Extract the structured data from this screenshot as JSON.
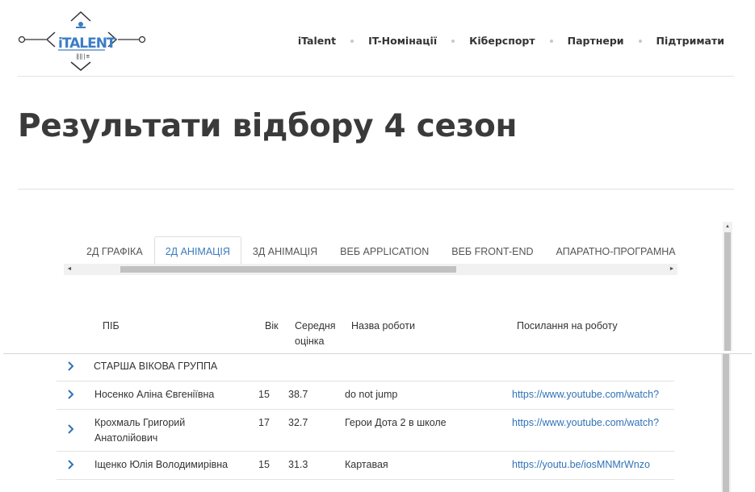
{
  "header": {
    "nav": [
      "iTalent",
      "IT-Номінації",
      "Кіберспорт",
      "Партнери",
      "Підтримати"
    ]
  },
  "page": {
    "title": "Результати відбору 4 сезон"
  },
  "tabs": {
    "items": [
      "2Д ГРАФІКА",
      "2Д АНІМАЦІЯ",
      "3Д АНІМАЦІЯ",
      "ВЕБ APPLICATION",
      "ВЕБ FRONT-END",
      "АПАРАТНО-ПРОГРАМНА РОЗ"
    ],
    "active_index": 1
  },
  "table": {
    "headers": {
      "name": "ПІБ",
      "age": "Вік",
      "score_line1": "Середня",
      "score_line2": "оцінка",
      "work": "Назва роботи",
      "link": "Посилання на роботу"
    },
    "group_label": "СТАРША ВІКОВА ГРУППА",
    "rows": [
      {
        "name": "Носенко Аліна Євгеніївна",
        "age": "15",
        "score": "38.7",
        "work": "do not jump",
        "link": "https://www.youtube.com/watch?"
      },
      {
        "name_line1": "Крохмаль Григорий",
        "name_line2": "Анатолійович",
        "age": "17",
        "score": "32.7",
        "work": "Герои Дота 2 в школе",
        "link": "https://www.youtube.com/watch?"
      },
      {
        "name": "Іщенко Юлія Володимирівна",
        "age": "15",
        "score": "31.3",
        "work": "Картавая",
        "link": "https://youtu.be/iosMNMrWnzo"
      }
    ]
  },
  "colors": {
    "accent": "#3a7abf",
    "link": "#2f73b7",
    "text": "#333333",
    "title": "#3a3a3a"
  },
  "icons": {
    "expand": "chevron-right-icon",
    "logo": "italent-logo"
  }
}
